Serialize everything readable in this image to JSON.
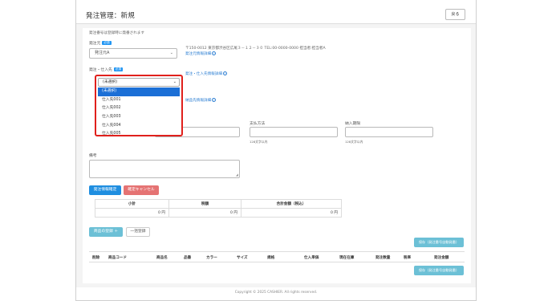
{
  "header": {
    "title": "発注管理：新規",
    "back_label": "戻る"
  },
  "form": {
    "note": "発注番号は登録時に発番されます",
    "supplier_from": {
      "label": "発注元",
      "badge": "必須",
      "value": "発注元A",
      "address": "〒150-0012 東京都渋谷区広尾３－１２－３０ TEL:00-0000-0000 担当者:担当者A",
      "detail_link": "発注元情報詳細"
    },
    "supplier_to": {
      "label": "発注・仕入先",
      "badge": "必須",
      "detail_link": "発注・仕入先情報詳細",
      "dropdown": {
        "selected": "(未選択)",
        "options": [
          "(未選択)",
          "仕入先001",
          "仕入先002",
          "仕入先003",
          "仕入先004",
          "仕入先005"
        ]
      }
    },
    "delivery_link": "納品先情報詳細",
    "payment": {
      "label": "支払方法",
      "hint": "128文字以内"
    },
    "delivery_time": {
      "label": "納入期限",
      "hint": "128文字以内"
    },
    "remarks": {
      "label": "備考"
    }
  },
  "buttons": {
    "confirm": "発注情報確定",
    "cancel": "確定キャンセル",
    "add_item": "商品の登録 ＋",
    "bulk_register": "一括登録",
    "save_top": "保存（発注番号自動発番）",
    "save_bottom": "保存（発注番号自動発番）"
  },
  "summary": {
    "headers": [
      "小計",
      "税額",
      "合計金額（税込）"
    ],
    "values": [
      "0 円",
      "0 円",
      "0 円"
    ]
  },
  "items_table": {
    "headers": [
      "削除",
      "商品コード",
      "商品名",
      "品番",
      "カラー",
      "サイズ",
      "規格",
      "仕入単価",
      "現在在庫",
      "発注数量",
      "税率",
      "発注金額"
    ]
  },
  "footer": "Copyright © 2025 CASHIER. All rights reserved."
}
